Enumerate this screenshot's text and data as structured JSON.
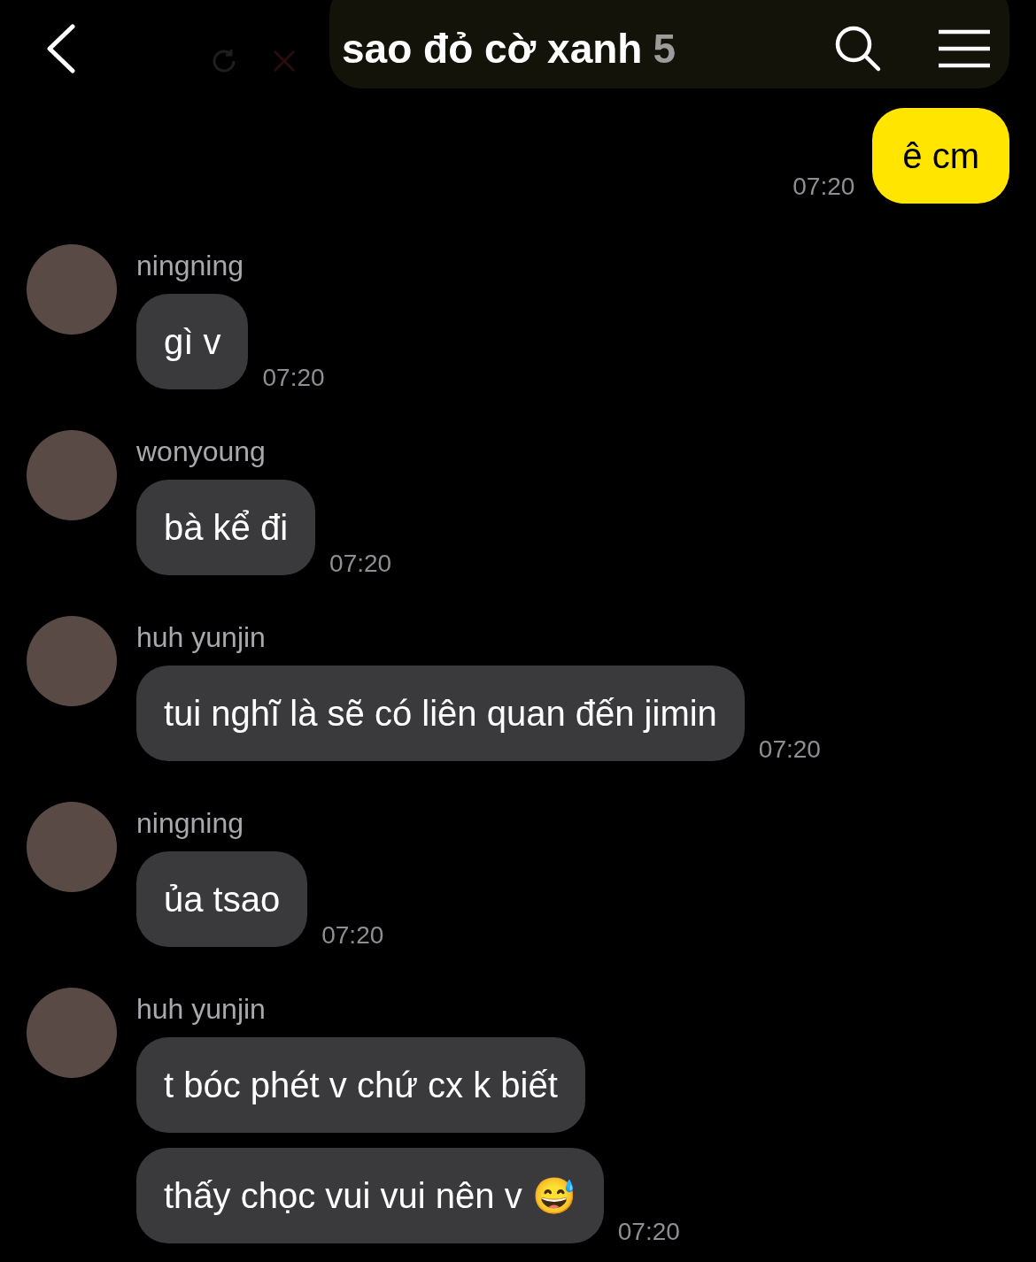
{
  "header": {
    "title": "sao đỏ cờ xanh",
    "member_count": "5"
  },
  "messages": [
    {
      "kind": "outgoing",
      "bubbles": [
        "ê cm"
      ],
      "time": "07:20"
    },
    {
      "kind": "incoming",
      "sender": "ningning",
      "bubbles": [
        "gì v"
      ],
      "time": "07:20"
    },
    {
      "kind": "incoming",
      "sender": "wonyoung",
      "bubbles": [
        "bà kể đi"
      ],
      "time": "07:20"
    },
    {
      "kind": "incoming",
      "sender": "huh yunjin",
      "bubbles": [
        "tui nghĩ là sẽ có liên quan đến jimin"
      ],
      "time": "07:20"
    },
    {
      "kind": "incoming",
      "sender": "ningning",
      "bubbles": [
        "ủa tsao"
      ],
      "time": "07:20"
    },
    {
      "kind": "incoming",
      "sender": "huh yunjin",
      "bubbles": [
        "t bóc phét v chứ cx k biết",
        "thấy chọc vui vui nên v 😅"
      ],
      "time": "07:20"
    }
  ]
}
